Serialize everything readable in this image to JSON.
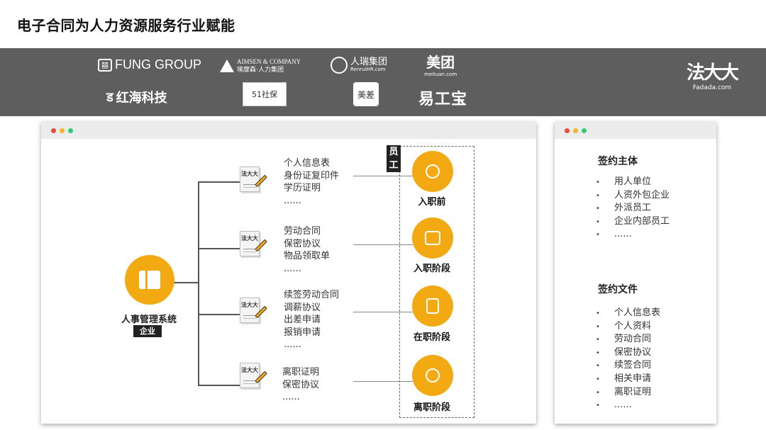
{
  "title": "电子合同为人力资源服务行业赋能",
  "logos": {
    "fung": "FUNG GROUP",
    "aimsen_en": "AIMSEN & COMPANY",
    "aimsen_cn": "埃摩森·人力集团",
    "renrui": "人瑞集团",
    "renrui_sub": "RenruiHR.com",
    "meituan": "美团",
    "meituan_sub": "meituan.com",
    "hongha": "红海科技",
    "x51": "51社保",
    "meichai": "美差",
    "yigong": "易工宝",
    "fadada": "法大大",
    "fadada_sub": "Fadada.com"
  },
  "hr_system": {
    "label": "人事管理系统",
    "tag": "企业"
  },
  "doc_icon_text": "法大大",
  "groups": [
    {
      "items": [
        "个人信息表",
        "身份证复印件",
        "学历证明",
        "......"
      ]
    },
    {
      "items": [
        "劳动合同",
        "保密协议",
        "物品领取单",
        "......"
      ]
    },
    {
      "items": [
        "续签劳动合同",
        "调薪协议",
        "出差申请",
        "报销申请",
        "......"
      ]
    },
    {
      "items": [
        "离职证明",
        "保密协议",
        "......"
      ]
    }
  ],
  "employee_tag": "员工",
  "stages": [
    {
      "label": "入职前",
      "icon": "user-add-icon"
    },
    {
      "label": "入职阶段",
      "icon": "id-card-icon"
    },
    {
      "label": "在职阶段",
      "icon": "document-icon"
    },
    {
      "label": "离职阶段",
      "icon": "user-exit-icon"
    }
  ],
  "side": {
    "subject_title": "签约主体",
    "subjects": [
      "用人单位",
      "人资外包企业",
      "外派员工",
      "企业内部员工",
      "......"
    ],
    "files_title": "签约文件",
    "files": [
      "个人信息表",
      "个人资料",
      "劳动合同",
      "保密协议",
      "续签合同",
      "相关申请",
      "离职证明",
      "......"
    ]
  },
  "colors": {
    "accent": "#f3a912",
    "banner": "#5e5e5e"
  }
}
